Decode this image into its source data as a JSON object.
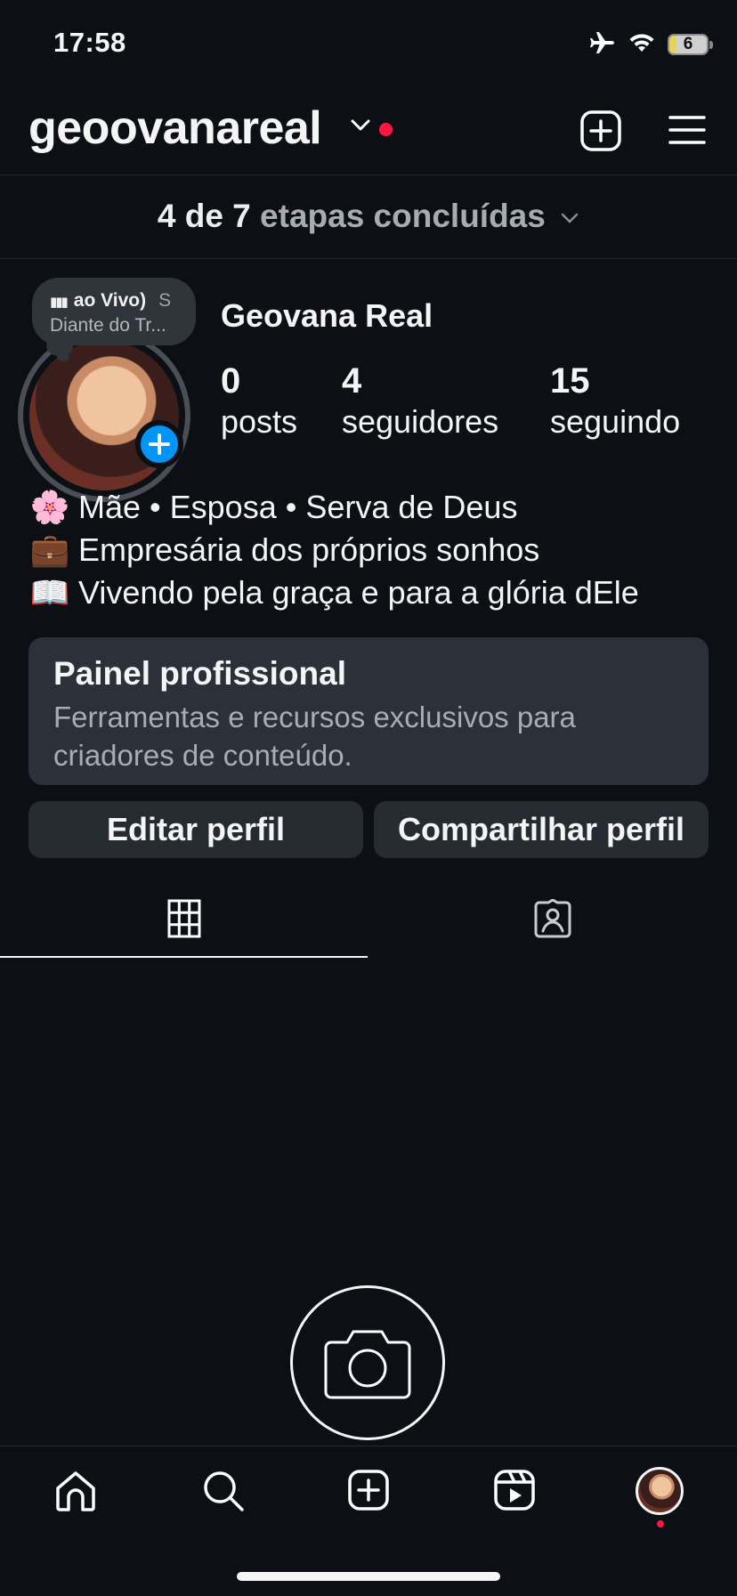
{
  "status_bar": {
    "time": "17:58",
    "icons": [
      "airplane-icon",
      "wifi-icon",
      "battery-icon"
    ],
    "battery": "6"
  },
  "header": {
    "username": "geoovanareal",
    "icons": [
      "chevron-down-icon",
      "new-post-icon",
      "menu-icon"
    ],
    "notification_color": "#ff1744"
  },
  "progress": {
    "done": "4 de 7",
    "label": "etapas concluídas"
  },
  "note": {
    "line1": "ao Vivo)",
    "line1_extra": "S",
    "line2": "Diante do Tr..."
  },
  "profile": {
    "display_name": "Geovana Real",
    "stats": [
      {
        "value": "0",
        "label": "posts"
      },
      {
        "value": "4",
        "label": "seguidores"
      },
      {
        "value": "15",
        "label": "seguindo"
      }
    ],
    "bio": [
      {
        "emoji": "🌸",
        "text": "Mãe • Esposa • Serva de Deus"
      },
      {
        "emoji": "💼",
        "text": "Empresária dos próprios sonhos"
      },
      {
        "emoji": "📖",
        "text": "Vivendo pela graça e para a glória dEle"
      }
    ]
  },
  "pro_panel": {
    "title": "Painel profissional",
    "subtitle": "Ferramentas e recursos exclusivos para criadores de conteúdo."
  },
  "buttons": {
    "edit": "Editar perfil",
    "share": "Compartilhar perfil"
  },
  "tabs": [
    "grid-icon",
    "tagged-icon"
  ],
  "bottom_nav": [
    "home-icon",
    "search-icon",
    "create-icon",
    "reels-icon",
    "profile-avatar"
  ],
  "colors": {
    "background": "#0c0f14",
    "accent_blue": "#0095f6",
    "panel": "#2c3038"
  }
}
